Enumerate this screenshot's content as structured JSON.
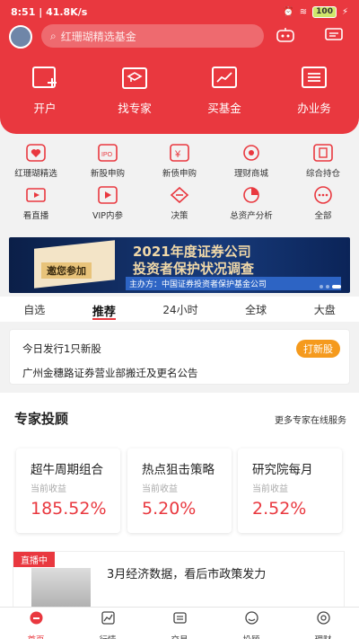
{
  "status": {
    "time": "8:51",
    "speed": "41.8K/s",
    "battery": "100"
  },
  "search": {
    "placeholder": "红珊瑚精选基金"
  },
  "main_nav": [
    {
      "label": "开户",
      "icon": "plus-box-icon"
    },
    {
      "label": "找专家",
      "icon": "graduate-icon"
    },
    {
      "label": "买基金",
      "icon": "chart-box-icon"
    },
    {
      "label": "办业务",
      "icon": "list-icon"
    }
  ],
  "grid": [
    {
      "label": "红珊瑚精选",
      "icon": "heart-icon"
    },
    {
      "label": "新股申购",
      "icon": "ipo-icon"
    },
    {
      "label": "新债申购",
      "icon": "yen-icon"
    },
    {
      "label": "理财商城",
      "icon": "shop-icon"
    },
    {
      "label": "综合持仓",
      "icon": "holdings-icon"
    },
    {
      "label": "看直播",
      "icon": "live-icon"
    },
    {
      "label": "VIP内参",
      "icon": "play-icon"
    },
    {
      "label": "决策",
      "icon": "decision-icon"
    },
    {
      "label": "总资产分析",
      "icon": "asset-icon"
    },
    {
      "label": "全部",
      "icon": "more-icon"
    }
  ],
  "banner": {
    "join": "邀您参加",
    "title1": "2021年度证券公司",
    "title2": "投资者保护状况调查",
    "sponsor": "主办方：中国证券投资者保护基金公司"
  },
  "tabs": [
    "自选",
    "推荐",
    "24小时",
    "全球",
    "大盘"
  ],
  "news": {
    "line1": "今日发行1只新股",
    "line2": "广州金穗路证券营业部搬迁及更名公告",
    "button": "打新股"
  },
  "expert": {
    "title": "专家投顾",
    "more": "更多专家在线服务",
    "cards": [
      {
        "name": "超牛周期组合",
        "label": "当前收益",
        "value": "185.52%"
      },
      {
        "name": "热点狙击策略",
        "label": "当前收益",
        "value": "5.20%"
      },
      {
        "name": "研究院每月",
        "label": "当前收益",
        "value": "2.52%"
      }
    ]
  },
  "live": {
    "tag": "直播中",
    "title": "3月经济数据，看后市政策发力"
  },
  "bottom_nav": [
    {
      "label": "首页"
    },
    {
      "label": "行情"
    },
    {
      "label": "交易"
    },
    {
      "label": "投顾"
    },
    {
      "label": "理财"
    }
  ],
  "colors": {
    "accent": "#e9383f",
    "orange": "#f59a1d"
  }
}
